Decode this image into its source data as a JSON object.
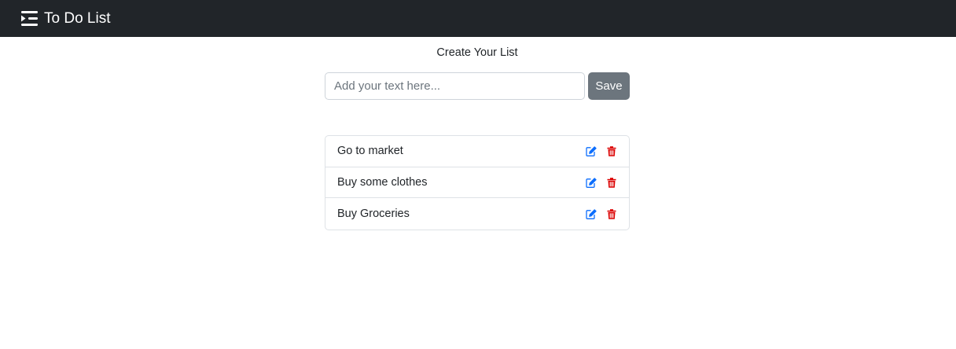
{
  "navbar": {
    "title": "To Do List",
    "icon": "list-indent-icon",
    "background": "#212529"
  },
  "main": {
    "heading": "Create Your List",
    "input": {
      "placeholder": "Add your text here...",
      "value": ""
    },
    "save_label": "Save"
  },
  "todos": [
    {
      "text": "Go to market"
    },
    {
      "text": "Buy some clothes"
    },
    {
      "text": "Buy Groceries"
    }
  ],
  "icons": {
    "edit": "edit-icon",
    "delete": "trash-icon"
  },
  "colors": {
    "edit": "#0d6efd",
    "delete": "#dc0000",
    "save_button": "#6c757d"
  }
}
